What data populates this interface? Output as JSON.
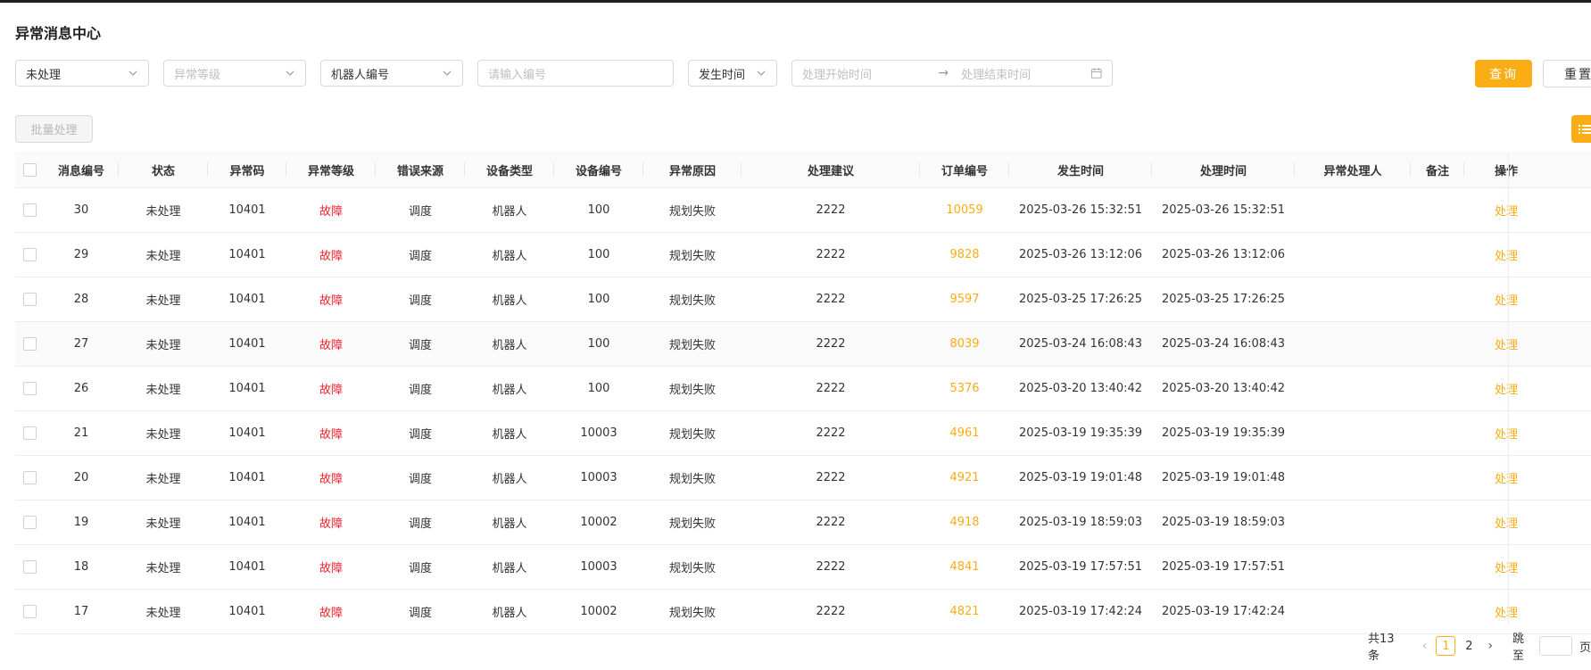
{
  "page": {
    "title": "异常消息中心"
  },
  "filters": {
    "status": "未处理",
    "level_placeholder": "异常等级",
    "robot": "机器人编号",
    "number_placeholder": "请输入编号",
    "time_type": "发生时间",
    "start_placeholder": "处理开始时间",
    "end_placeholder": "处理结束时间"
  },
  "buttons": {
    "query": "查询",
    "reset": "重置",
    "batch": "批量处理"
  },
  "table": {
    "columns": [
      "消息编号",
      "状态",
      "异常码",
      "异常等级",
      "错误来源",
      "设备类型",
      "设备编号",
      "异常原因",
      "处理建议",
      "订单编号",
      "发生时间",
      "处理时间",
      "异常处理人",
      "备注",
      "操作"
    ],
    "rows": [
      {
        "id": "30",
        "status": "未处理",
        "code": "10401",
        "level": "故障",
        "source": "调度",
        "device_type": "机器人",
        "device_no": "100",
        "reason": "规划失败",
        "advice": "2222",
        "order": "10059",
        "occur": "2025-03-26 15:32:51",
        "handle": "2025-03-26 15:32:51",
        "handler": "",
        "note": "",
        "action": "处理"
      },
      {
        "id": "29",
        "status": "未处理",
        "code": "10401",
        "level": "故障",
        "source": "调度",
        "device_type": "机器人",
        "device_no": "100",
        "reason": "规划失败",
        "advice": "2222",
        "order": "9828",
        "occur": "2025-03-26 13:12:06",
        "handle": "2025-03-26 13:12:06",
        "handler": "",
        "note": "",
        "action": "处理"
      },
      {
        "id": "28",
        "status": "未处理",
        "code": "10401",
        "level": "故障",
        "source": "调度",
        "device_type": "机器人",
        "device_no": "100",
        "reason": "规划失败",
        "advice": "2222",
        "order": "9597",
        "occur": "2025-03-25 17:26:25",
        "handle": "2025-03-25 17:26:25",
        "handler": "",
        "note": "",
        "action": "处理"
      },
      {
        "id": "27",
        "status": "未处理",
        "code": "10401",
        "level": "故障",
        "source": "调度",
        "device_type": "机器人",
        "device_no": "100",
        "reason": "规划失败",
        "advice": "2222",
        "order": "8039",
        "occur": "2025-03-24 16:08:43",
        "handle": "2025-03-24 16:08:43",
        "handler": "",
        "note": "",
        "action": "处理"
      },
      {
        "id": "26",
        "status": "未处理",
        "code": "10401",
        "level": "故障",
        "source": "调度",
        "device_type": "机器人",
        "device_no": "100",
        "reason": "规划失败",
        "advice": "2222",
        "order": "5376",
        "occur": "2025-03-20 13:40:42",
        "handle": "2025-03-20 13:40:42",
        "handler": "",
        "note": "",
        "action": "处理"
      },
      {
        "id": "21",
        "status": "未处理",
        "code": "10401",
        "level": "故障",
        "source": "调度",
        "device_type": "机器人",
        "device_no": "10003",
        "reason": "规划失败",
        "advice": "2222",
        "order": "4961",
        "occur": "2025-03-19 19:35:39",
        "handle": "2025-03-19 19:35:39",
        "handler": "",
        "note": "",
        "action": "处理"
      },
      {
        "id": "20",
        "status": "未处理",
        "code": "10401",
        "level": "故障",
        "source": "调度",
        "device_type": "机器人",
        "device_no": "10003",
        "reason": "规划失败",
        "advice": "2222",
        "order": "4921",
        "occur": "2025-03-19 19:01:48",
        "handle": "2025-03-19 19:01:48",
        "handler": "",
        "note": "",
        "action": "处理"
      },
      {
        "id": "19",
        "status": "未处理",
        "code": "10401",
        "level": "故障",
        "source": "调度",
        "device_type": "机器人",
        "device_no": "10002",
        "reason": "规划失败",
        "advice": "2222",
        "order": "4918",
        "occur": "2025-03-19 18:59:03",
        "handle": "2025-03-19 18:59:03",
        "handler": "",
        "note": "",
        "action": "处理"
      },
      {
        "id": "18",
        "status": "未处理",
        "code": "10401",
        "level": "故障",
        "source": "调度",
        "device_type": "机器人",
        "device_no": "10003",
        "reason": "规划失败",
        "advice": "2222",
        "order": "4841",
        "occur": "2025-03-19 17:57:51",
        "handle": "2025-03-19 17:57:51",
        "handler": "",
        "note": "",
        "action": "处理"
      },
      {
        "id": "17",
        "status": "未处理",
        "code": "10401",
        "level": "故障",
        "source": "调度",
        "device_type": "机器人",
        "device_no": "10002",
        "reason": "规划失败",
        "advice": "2222",
        "order": "4821",
        "occur": "2025-03-19 17:42:24",
        "handle": "2025-03-19 17:42:24",
        "handler": "",
        "note": "",
        "action": "处理"
      }
    ]
  },
  "pagination": {
    "total": "共13条",
    "pages": [
      "1",
      "2"
    ],
    "current": "1",
    "jump_label": "跳至",
    "jump_suffix": "页"
  },
  "colors": {
    "accent": "#faad14",
    "fault": "#f5222d"
  },
  "icons": {
    "dropdown": "chevron-down-icon",
    "calendar": "calendar-icon",
    "range": "arrow-right-icon",
    "column_setting": "list-icon"
  }
}
